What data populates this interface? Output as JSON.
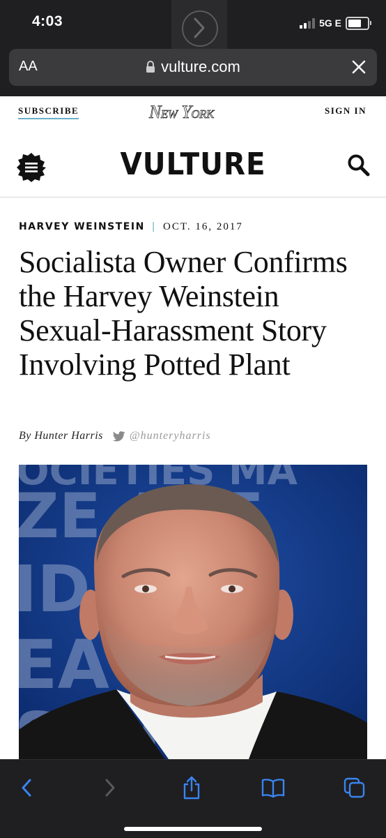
{
  "status_bar": {
    "time": "4:03",
    "network": "5G E"
  },
  "browser": {
    "text_size_label": "AA",
    "url": "vulture.com"
  },
  "nymag_bar": {
    "subscribe": "SUBSCRIBE",
    "logo": "NEW YORK",
    "sign_in": "SIGN IN"
  },
  "site": {
    "logo": "VULTURE"
  },
  "article": {
    "kicker": "HARVEY WEINSTEIN",
    "date": "OCT. 16, 2017",
    "headline": "Socialista Owner Confirms the Harvey Weinstein Sexual-Harassment Story Involving Potted Plant",
    "byline": "By Hunter Harris",
    "twitter_handle": "@hunteryharris"
  },
  "hero_backdrop": {
    "row1": "OCIETIES MA",
    "row2": "ZE  AKT",
    "row3": "ID  TAI",
    "row4": "EA  OU",
    "row5": "SO  MA"
  },
  "icons": [
    "lock-icon",
    "close-icon",
    "menu-icon",
    "search-icon",
    "twitter-icon",
    "back-icon",
    "forward-icon",
    "share-icon",
    "bookmarks-icon",
    "tabs-icon"
  ],
  "colors": {
    "accent_blue": "#6ab0c8",
    "toolbar_blue": "#3a84f0",
    "chrome_dark": "#1f1f21"
  }
}
